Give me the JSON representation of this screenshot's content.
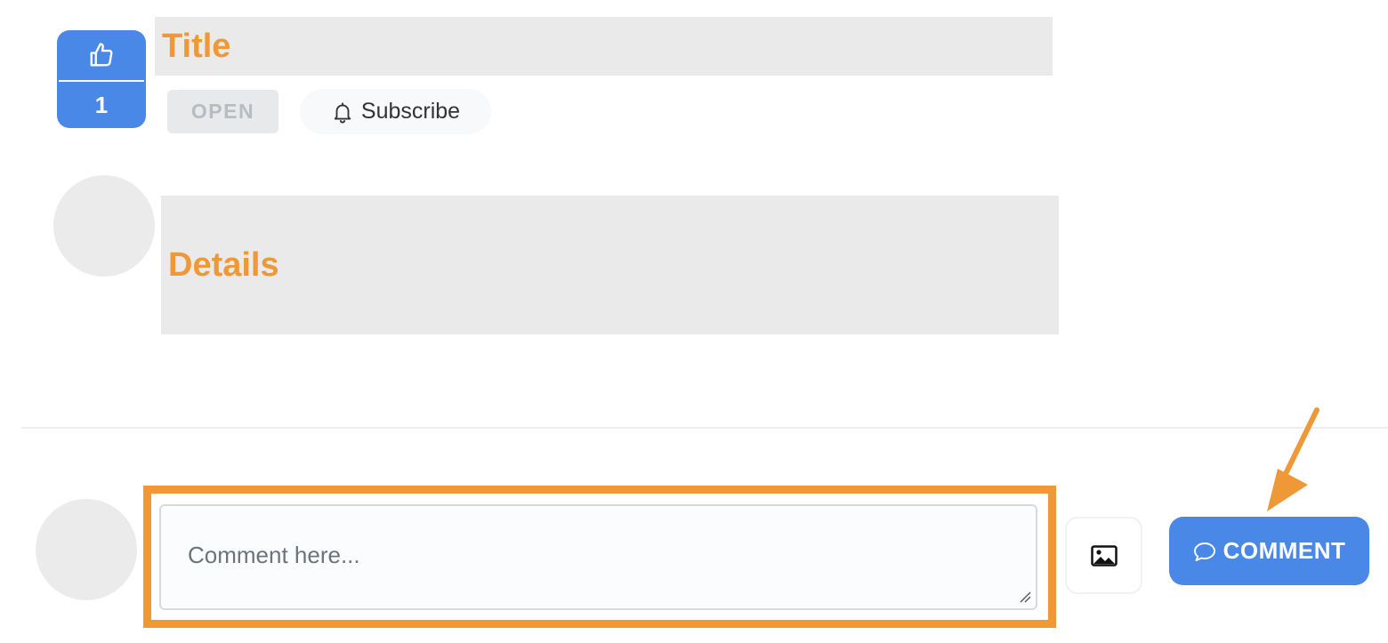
{
  "post": {
    "vote_count": "1",
    "title": "Title",
    "status": "OPEN",
    "subscribe_label": "Subscribe",
    "details": "Details"
  },
  "composer": {
    "placeholder": "Comment here...",
    "comment_button_label": "COMMENT"
  },
  "icons": {
    "vote": "thumbs-up-icon",
    "subscribe": "bell-icon",
    "attach": "image-icon",
    "comment": "speech-bubble-icon"
  },
  "colors": {
    "accent": "#4a88e8",
    "annotation": "#ef9838",
    "placeholder_block": "#eaeaea"
  }
}
